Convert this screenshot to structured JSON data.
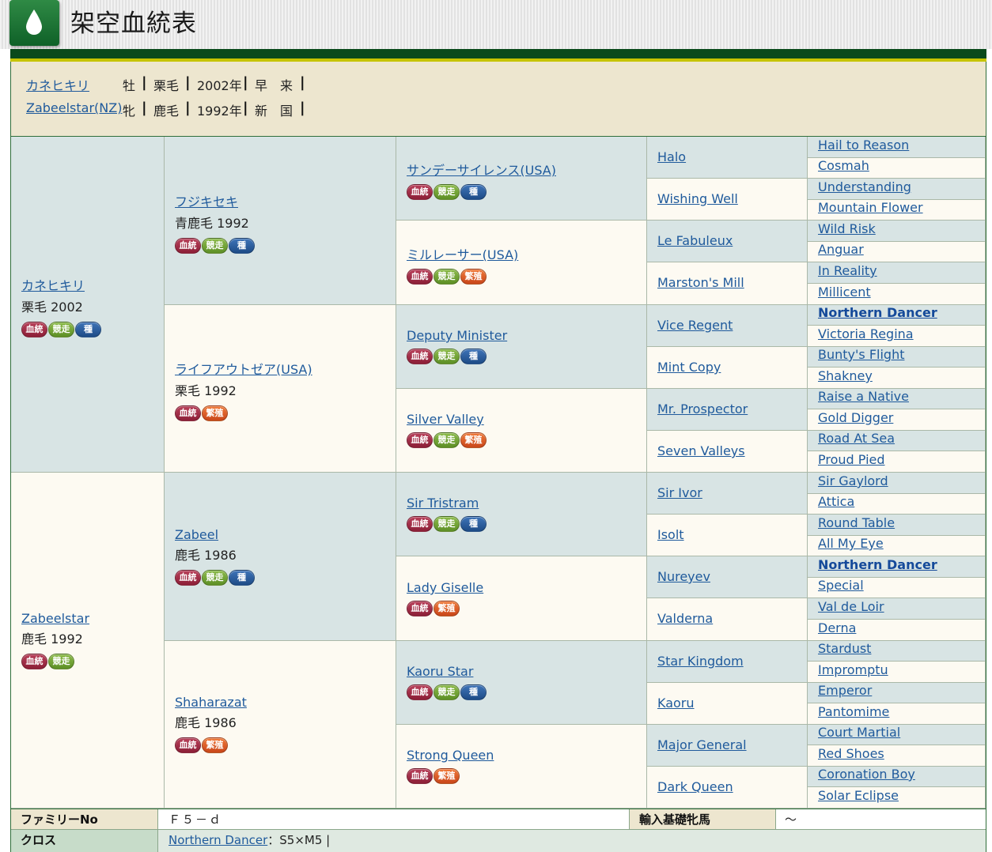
{
  "header": {
    "title": "架空血統表",
    "icon": "drop-icon"
  },
  "summary": [
    {
      "name": "カネヒキリ",
      "sex": "牡",
      "color": "栗毛",
      "year": "2002年",
      "origin": "早　来"
    },
    {
      "name": "Zabeelstar(NZ)",
      "sex": "牝",
      "color": "鹿毛",
      "year": "1992年",
      "origin": "新　国"
    }
  ],
  "badge_labels": {
    "blood": "血統",
    "race": "競走",
    "stud": "種",
    "breed": "繁殖"
  },
  "colors": {
    "header_green": "#0a4a1b",
    "gold_line": "#c6c400",
    "summary_bg": "#ede6cf",
    "cell_blue": "#d8e4e4",
    "cell_cream": "#fdfaf2",
    "link": "#1f5a9c"
  },
  "pedigree": {
    "gen1": [
      {
        "name": "カネヒキリ",
        "info": "栗毛 2002",
        "badges": [
          "blood",
          "race",
          "stud"
        ]
      },
      {
        "name": "Zabeelstar",
        "info": "鹿毛 1992",
        "badges": [
          "blood",
          "race"
        ]
      }
    ],
    "gen2": [
      {
        "name": "フジキセキ",
        "info": "青鹿毛 1992",
        "badges": [
          "blood",
          "race",
          "stud"
        ]
      },
      {
        "name": "ライフアウトゼア(USA)",
        "info": "栗毛 1992",
        "badges": [
          "blood",
          "breed"
        ]
      },
      {
        "name": "Zabeel",
        "info": "鹿毛 1986",
        "badges": [
          "blood",
          "race",
          "stud"
        ]
      },
      {
        "name": "Shaharazat",
        "info": "鹿毛 1986",
        "badges": [
          "blood",
          "breed"
        ]
      }
    ],
    "gen3": [
      {
        "name": "サンデーサイレンス(USA)",
        "badges": [
          "blood",
          "race",
          "stud"
        ]
      },
      {
        "name": "ミルレーサー(USA)",
        "badges": [
          "blood",
          "race",
          "breed"
        ]
      },
      {
        "name": "Deputy Minister",
        "badges": [
          "blood",
          "race",
          "stud"
        ]
      },
      {
        "name": "Silver Valley",
        "badges": [
          "blood",
          "race",
          "breed"
        ]
      },
      {
        "name": "Sir Tristram",
        "badges": [
          "blood",
          "race",
          "stud"
        ]
      },
      {
        "name": "Lady Giselle",
        "badges": [
          "blood",
          "breed"
        ]
      },
      {
        "name": "Kaoru Star",
        "badges": [
          "blood",
          "race",
          "stud"
        ]
      },
      {
        "name": "Strong Queen",
        "badges": [
          "blood",
          "breed"
        ]
      }
    ],
    "gen4": [
      "Halo",
      "Wishing Well",
      "Le Fabuleux",
      "Marston's Mill",
      "Vice Regent",
      "Mint Copy",
      "Mr. Prospector",
      "Seven Valleys",
      "Sir Ivor",
      "Isolt",
      "Nureyev",
      "Valderna",
      "Star Kingdom",
      "Kaoru",
      "Major General",
      "Dark Queen"
    ],
    "gen5": [
      "Hail to Reason",
      "Cosmah",
      "Understanding",
      "Mountain Flower",
      "Wild Risk",
      "Anguar",
      "In Reality",
      "Millicent",
      "Northern Dancer",
      "Victoria Regina",
      "Bunty's Flight",
      "Shakney",
      "Raise a Native",
      "Gold Digger",
      "Road At Sea",
      "Proud Pied",
      "Sir Gaylord",
      "Attica",
      "Round Table",
      "All My Eye",
      "Northern Dancer",
      "Special",
      "Val de Loir",
      "Derna",
      "Stardust",
      "Impromptu",
      "Emperor",
      "Pantomime",
      "Court Martial",
      "Red Shoes",
      "Coronation Boy",
      "Solar Eclipse"
    ]
  },
  "footer": {
    "family_label": "ファミリーNo",
    "family_value": "Ｆ５－ｄ",
    "import_label": "輸入基礎牝馬",
    "import_value": "～",
    "cross_label": "クロス",
    "cross_link": "Northern Dancer",
    "cross_text": "：S5×M5 |"
  }
}
